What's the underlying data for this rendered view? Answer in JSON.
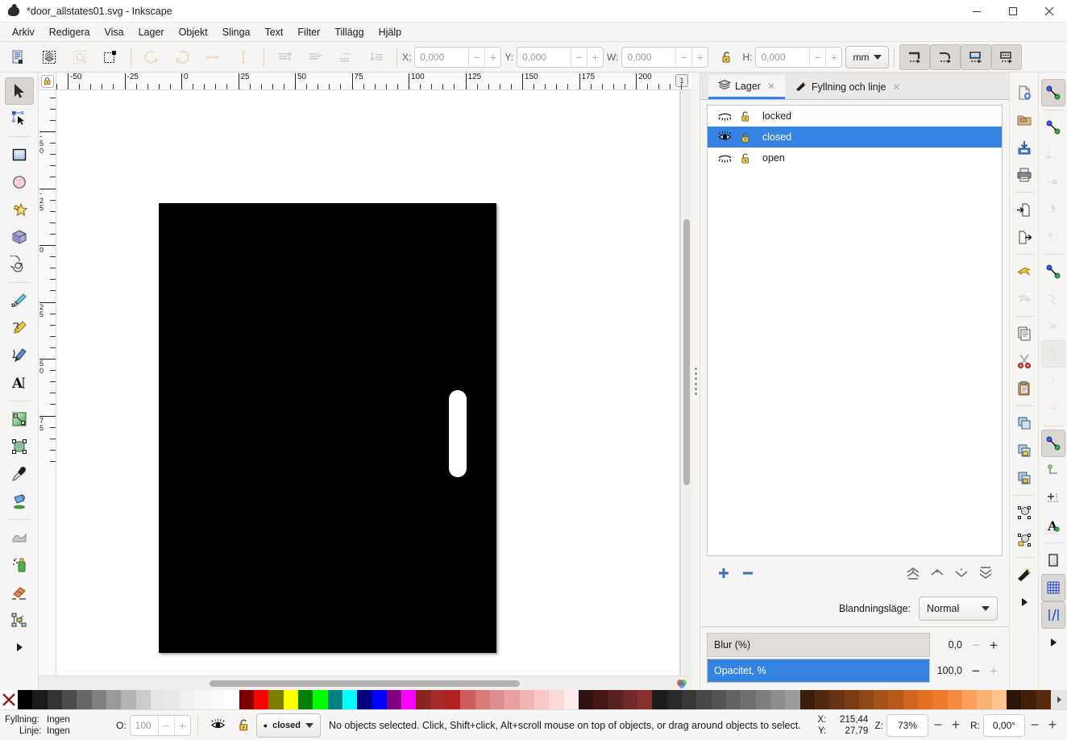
{
  "window": {
    "title": "*door_allstates01.svg - Inkscape",
    "minimize_label": "Minimera",
    "maximize_label": "Maximera",
    "close_label": "Stäng"
  },
  "menubar": {
    "items": [
      {
        "label": "Arkiv"
      },
      {
        "label": "Redigera"
      },
      {
        "label": "Visa"
      },
      {
        "label": "Lager"
      },
      {
        "label": "Objekt"
      },
      {
        "label": "Slinga"
      },
      {
        "label": "Text"
      },
      {
        "label": "Filter"
      },
      {
        "label": "Tillägg"
      },
      {
        "label": "Hjälp"
      }
    ]
  },
  "toolbar": {
    "select_all_icon": "select-all-icon",
    "select_all_layers_icon": "select-all-in-layers-icon",
    "deselect_icon": "deselect-icon",
    "edit_selection_icon": "edit-selection-icon",
    "rotate_ccw_icon": "rotate-counterclockwise-icon",
    "rotate_cw_icon": "rotate-clockwise-icon",
    "flip_h_icon": "flip-horizontal-icon",
    "flip_v_icon": "flip-vertical-icon",
    "raise_to_top_icon": "raise-to-top-icon",
    "raise_icon": "raise-icon",
    "lower_icon": "lower-icon",
    "lower_to_bottom_icon": "lower-to-bottom-icon",
    "x_label": "X:",
    "x_value": "0,000",
    "y_label": "Y:",
    "y_value": "0,000",
    "w_label": "W:",
    "w_value": "0,000",
    "h_label": "H:",
    "h_value": "0,000",
    "lock_ratio_icon": "lock-aspect-ratio-icon",
    "unit_value": "mm",
    "affect_stroke_icon": "affect-stroke-width-icon",
    "affect_corners_icon": "affect-rounded-corners-icon",
    "affect_gradients_icon": "affect-gradients-icon",
    "affect_patterns_icon": "affect-patterns-icon"
  },
  "toolbox": {
    "tools": [
      {
        "name": "selector-tool",
        "icon": "arrow-cursor-icon",
        "active": true
      },
      {
        "name": "node-tool",
        "icon": "node-editor-icon",
        "active": false
      },
      {
        "name": "rectangle-tool",
        "icon": "rectangle-icon",
        "active": false
      },
      {
        "name": "ellipse-tool",
        "icon": "ellipse-icon",
        "active": false
      },
      {
        "name": "star-tool",
        "icon": "star-icon",
        "active": false
      },
      {
        "name": "box3d-tool",
        "icon": "3d-box-icon",
        "active": false
      },
      {
        "name": "spiral-tool",
        "icon": "spiral-icon",
        "active": false
      },
      {
        "name": "bezier-tool",
        "icon": "pen-icon",
        "active": false
      },
      {
        "name": "pencil-tool",
        "icon": "pencil-icon",
        "active": false
      },
      {
        "name": "calligraphy-tool",
        "icon": "calligraphy-pen-icon",
        "active": false
      },
      {
        "name": "text-tool",
        "icon": "text-a-icon",
        "active": false
      },
      {
        "name": "gradient-tool",
        "icon": "gradient-icon",
        "active": false
      },
      {
        "name": "mesh-tool",
        "icon": "mesh-gradient-icon",
        "active": false
      },
      {
        "name": "dropper-tool",
        "icon": "eyedropper-icon",
        "active": false
      },
      {
        "name": "paintbucket-tool",
        "icon": "paint-bucket-icon",
        "active": false
      },
      {
        "name": "tweak-tool",
        "icon": "tweak-icon",
        "active": false
      },
      {
        "name": "spray-tool",
        "icon": "spray-can-icon",
        "active": false
      },
      {
        "name": "eraser-tool",
        "icon": "eraser-icon",
        "active": false
      },
      {
        "name": "connector-tool",
        "icon": "connector-icon",
        "active": false
      }
    ],
    "more_icon": "expand-arrow-icon"
  },
  "rulers": {
    "horizontal_labels": [
      "-50",
      "-25",
      "0",
      "25",
      "50",
      "75",
      "100",
      "125",
      "150",
      "175",
      "200"
    ],
    "vertical_labels": [
      "-50",
      "-25",
      "0",
      "25",
      "50",
      "75"
    ],
    "page_indicator": "1",
    "lock_icon": "ruler-lock-icon"
  },
  "canvas": {
    "document_fill": "#000000",
    "handle_fill": "#ffffff",
    "background": "#ffffff"
  },
  "dock": {
    "tabs": [
      {
        "label": "Lager",
        "icon": "layers-icon",
        "active": true,
        "close_icon": "close-icon"
      },
      {
        "label": "Fyllning och linje",
        "icon": "fill-stroke-icon",
        "active": false,
        "close_icon": "close-icon"
      }
    ],
    "layers": [
      {
        "name": "locked",
        "visible": false,
        "locked": false,
        "selected": false
      },
      {
        "name": "closed",
        "visible": true,
        "locked": false,
        "selected": true
      },
      {
        "name": "open",
        "visible": false,
        "locked": false,
        "selected": false
      }
    ],
    "actions": {
      "add_icon": "add-layer-icon",
      "remove_icon": "remove-layer-icon",
      "raise_top_icon": "layer-to-top-icon",
      "raise_icon": "layer-raise-icon",
      "lower_icon": "layer-lower-icon",
      "lower_bottom_icon": "layer-to-bottom-icon"
    },
    "blend_label": "Blandningsläge:",
    "blend_value": "Normal",
    "blur_label": "Blur (%)",
    "blur_value": "0,0",
    "opacity_label": "Opacitet, %",
    "opacity_value": "100,0",
    "accent_color": "#3584e4"
  },
  "commandbar": {
    "items": [
      {
        "name": "new-document-button",
        "icon": "new-document-icon"
      },
      {
        "name": "open-document-button",
        "icon": "folder-open-icon"
      },
      {
        "name": "save-document-button",
        "icon": "save-icon"
      },
      {
        "name": "print-button",
        "icon": "printer-icon"
      },
      {
        "name": "import-button",
        "icon": "import-icon"
      },
      {
        "name": "export-button",
        "icon": "export-icon"
      },
      {
        "name": "undo-button",
        "icon": "undo-arrow-icon"
      },
      {
        "name": "redo-button",
        "icon": "redo-arrow-icon"
      },
      {
        "name": "copy-button",
        "icon": "copy-icon"
      },
      {
        "name": "cut-button",
        "icon": "scissors-icon"
      },
      {
        "name": "paste-button",
        "icon": "clipboard-paste-icon"
      },
      {
        "name": "duplicate-button",
        "icon": "duplicate-icon"
      },
      {
        "name": "clone-button",
        "icon": "clone-icon"
      },
      {
        "name": "unlink-clone-button",
        "icon": "unlink-clone-icon"
      },
      {
        "name": "group-button",
        "icon": "group-icon"
      },
      {
        "name": "ungroup-button",
        "icon": "ungroup-icon"
      },
      {
        "name": "fill-stroke-button",
        "icon": "fill-stroke-icon"
      }
    ],
    "more_icon": "expand-arrow-icon"
  },
  "snapbar": {
    "items": [
      {
        "name": "enable-snapping-toggle",
        "icon": "snap-icon",
        "active": true
      },
      {
        "name": "snap-bounding-box-toggle",
        "icon": "snap-bbox-icon",
        "active": false
      },
      {
        "name": "snap-bbox-corner-toggle",
        "icon": "snap-bbox-corner-icon",
        "active": false,
        "dim": true
      },
      {
        "name": "snap-bbox-edge-midpoint-toggle",
        "icon": "snap-bbox-edge-mid-icon",
        "active": false,
        "dim": true
      },
      {
        "name": "snap-bbox-center-toggle",
        "icon": "snap-bbox-center-icon",
        "active": false,
        "dim": true
      },
      {
        "name": "snap-bbox-edge-center-toggle",
        "icon": "snap-bbox-edge-center-icon",
        "active": false,
        "dim": true
      },
      {
        "name": "snap-nodes-toggle",
        "icon": "snap-nodes-icon",
        "active": false
      },
      {
        "name": "snap-paths-toggle",
        "icon": "snap-path-icon",
        "active": false,
        "dim": true
      },
      {
        "name": "snap-path-intersections-toggle",
        "icon": "snap-path-intersection-icon",
        "active": false,
        "dim": true
      },
      {
        "name": "snap-to-cusp-nodes-toggle",
        "icon": "snap-cusp-node-icon",
        "active": true,
        "dim": true
      },
      {
        "name": "snap-smooth-nodes-toggle",
        "icon": "snap-smooth-node-icon",
        "active": false,
        "dim": true
      },
      {
        "name": "snap-midpoints-toggle",
        "icon": "snap-midpoint-icon",
        "active": false,
        "dim": true
      },
      {
        "name": "snap-others-toggle",
        "icon": "snap-other-icon",
        "active": false
      },
      {
        "name": "snap-object-center-toggle",
        "icon": "snap-object-center-icon",
        "active": false
      },
      {
        "name": "snap-rotation-center-toggle",
        "icon": "snap-rotation-center-icon",
        "active": false
      },
      {
        "name": "snap-text-baseline-toggle",
        "icon": "snap-text-baseline-icon",
        "active": false
      },
      {
        "name": "snap-page-border-toggle",
        "icon": "snap-page-border-icon",
        "active": false
      },
      {
        "name": "snap-grid-toggle",
        "icon": "snap-grid-icon",
        "active": true
      },
      {
        "name": "snap-guides-toggle",
        "icon": "snap-guide-icon",
        "active": true
      }
    ],
    "more_icon": "expand-arrow-icon"
  },
  "palette": {
    "none_icon": "no-color-icon",
    "colors": [
      "#000000",
      "#1a1a1a",
      "#333333",
      "#4d4d4d",
      "#666666",
      "#808080",
      "#999999",
      "#b3b3b3",
      "#cccccc",
      "#e6e6e6",
      "#e9e9e9",
      "#f0f0f0",
      "#f6f6f6",
      "#fafafa",
      "#ffffff",
      "#800000",
      "#ff0000",
      "#808000",
      "#ffff00",
      "#008000",
      "#00ff00",
      "#008080",
      "#00ffff",
      "#000080",
      "#0000ff",
      "#800080",
      "#ff00ff",
      "#8b2323",
      "#a52a2a",
      "#b22222",
      "#cd5c5c",
      "#d97b7b",
      "#e08e8e",
      "#eaa0a0",
      "#f2b5b5",
      "#f7c8c8",
      "#fbdada",
      "#fdeaea",
      "#2f1010",
      "#451818",
      "#5b2020",
      "#712828",
      "#873030",
      "#1c1c1c",
      "#2a2a2a",
      "#383838",
      "#464646",
      "#545454",
      "#626262",
      "#707070",
      "#7e7e7e",
      "#8c8c8c",
      "#9a9a9a",
      "#3b1f0b",
      "#50290e",
      "#653311",
      "#7a3d14",
      "#8f4717",
      "#a4511a",
      "#b95b1d",
      "#ce6520",
      "#e36f23",
      "#f07a2d",
      "#f58c45",
      "#f99e5d",
      "#fbb075",
      "#fdc28d",
      "#2b1505",
      "#411f08",
      "#57290b"
    ],
    "scroll_icon": "palette-scroll-icon"
  },
  "statusbar": {
    "fill_label": "Fyllning:",
    "fill_value": "Ingen",
    "stroke_label": "Linje:",
    "stroke_value": "Ingen",
    "opacity_label": "O:",
    "opacity_value": "100",
    "visibility_icon": "eye-icon",
    "lock_icon": "unlocked-icon",
    "current_layer": "closed",
    "message": "No objects selected. Click, Shift+click, Alt+scroll mouse on top of objects, or drag around objects to select.",
    "x_label": "X:",
    "x_value": "215,44",
    "y_label": "Y:",
    "y_value": "27,79",
    "zoom_label": "Z:",
    "zoom_value": "73%",
    "rotation_label": "R:",
    "rotation_value": "0,00°"
  }
}
